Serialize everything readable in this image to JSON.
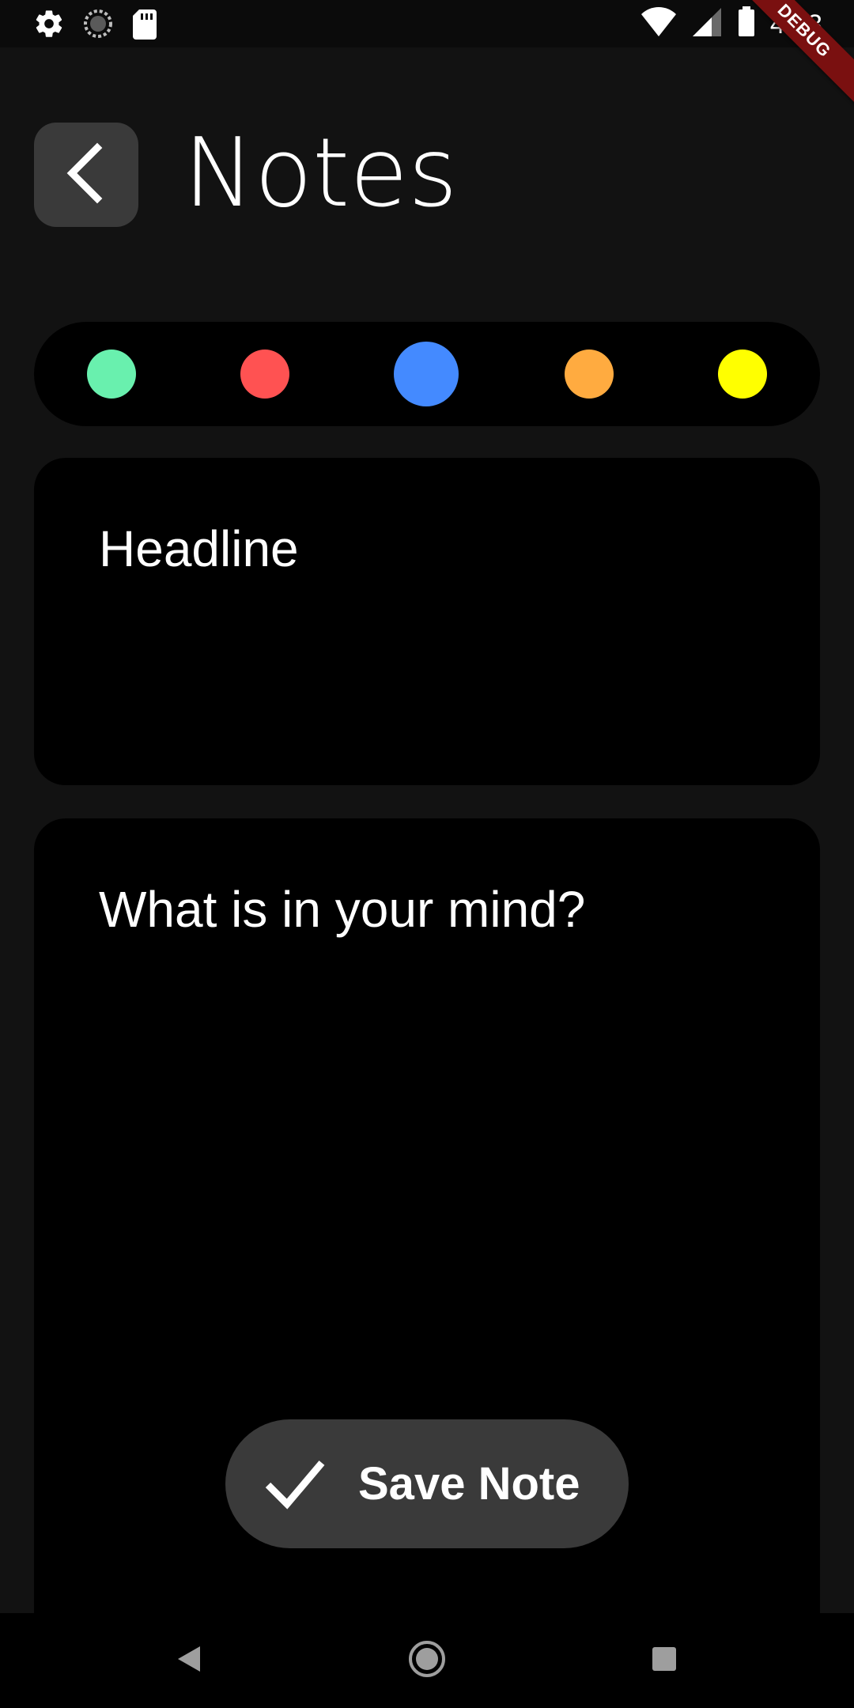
{
  "status_bar": {
    "time": "4:43",
    "left_icons": [
      "gear-icon",
      "sync-icon",
      "sd-card-icon"
    ],
    "right_icons": [
      "wifi-icon",
      "signal-icon",
      "battery-icon"
    ]
  },
  "debug_banner": {
    "label": "DEBUG",
    "color": "#7a1010"
  },
  "header": {
    "title": "Notes",
    "back_icon": "chevron-left-icon"
  },
  "color_picker": {
    "colors": [
      {
        "name": "green",
        "hex": "#69f0ae",
        "selected": false
      },
      {
        "name": "red",
        "hex": "#ff5252",
        "selected": false
      },
      {
        "name": "blue",
        "hex": "#448aff",
        "selected": true
      },
      {
        "name": "orange",
        "hex": "#ffab40",
        "selected": false
      },
      {
        "name": "yellow",
        "hex": "#ffff00",
        "selected": false
      }
    ]
  },
  "form": {
    "headline_placeholder": "Headline",
    "body_placeholder": "What is in your mind?"
  },
  "save_button": {
    "label": "Save Note",
    "icon": "check-icon"
  },
  "nav_bar": {
    "icons": [
      "back-triangle-icon",
      "home-circle-icon",
      "recents-square-icon"
    ]
  }
}
